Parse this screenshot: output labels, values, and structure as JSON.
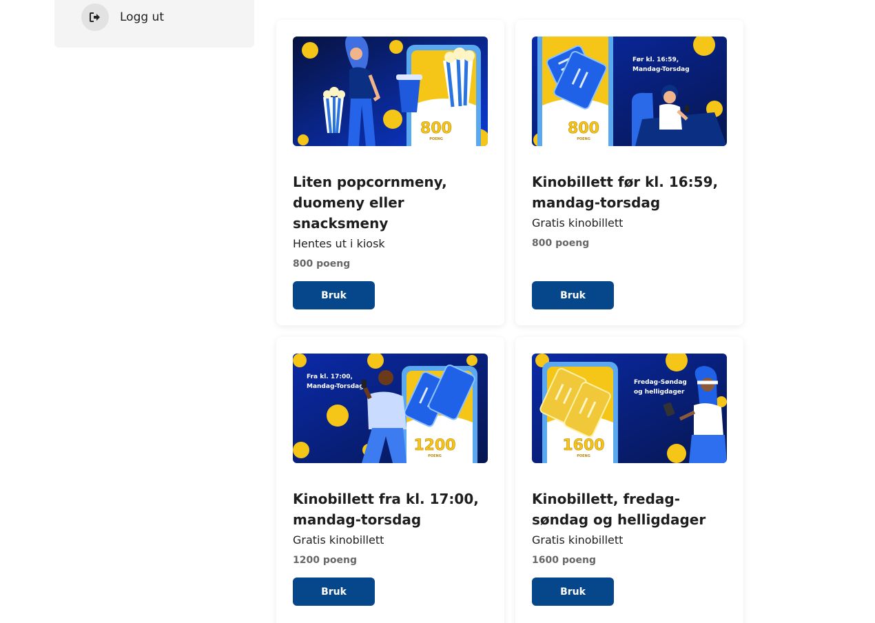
{
  "sidebar": {
    "logout_label": "Logg ut",
    "logout_icon": "logout-icon"
  },
  "cards": [
    {
      "title": "Liten popcornmeny, duomeny eller snacksmeny",
      "subtitle": "Hentes ut i kiosk",
      "points": "800 poeng",
      "button": "Bruk",
      "image_number": "800",
      "image_unit": "POENG"
    },
    {
      "title": "Kinobillett før kl. 16:59, mandag-torsdag",
      "subtitle": "Gratis kinobillett",
      "points": "800 poeng",
      "button": "Bruk",
      "image_number": "800",
      "image_unit": "POENG",
      "image_caption_1": "Før kl. 16:59,",
      "image_caption_2": "Mandag-Torsdag"
    },
    {
      "title": "Kinobillett fra kl. 17:00, mandag-torsdag",
      "subtitle": "Gratis kinobillett",
      "points": "1200 poeng",
      "button": "Bruk",
      "image_number": "1200",
      "image_unit": "POENG",
      "image_caption_1": "Fra kl. 17:00,",
      "image_caption_2": "Mandag-Torsdag"
    },
    {
      "title": "Kinobillett, fredag-søndag og helligdager",
      "subtitle": "Gratis kinobillett",
      "points": "1600 poeng",
      "button": "Bruk",
      "image_number": "1600",
      "image_unit": "POENG",
      "image_caption_1": "Fredag-Søndag",
      "image_caption_2": "og helligdager"
    }
  ],
  "colors": {
    "button": "#06468b",
    "image_bg_dark": "#071a4a",
    "image_bg_light": "#0a35c8",
    "coin": "#f5c518",
    "phone": "#5aa9f0",
    "sidebar_bg": "#f4f4f4"
  }
}
